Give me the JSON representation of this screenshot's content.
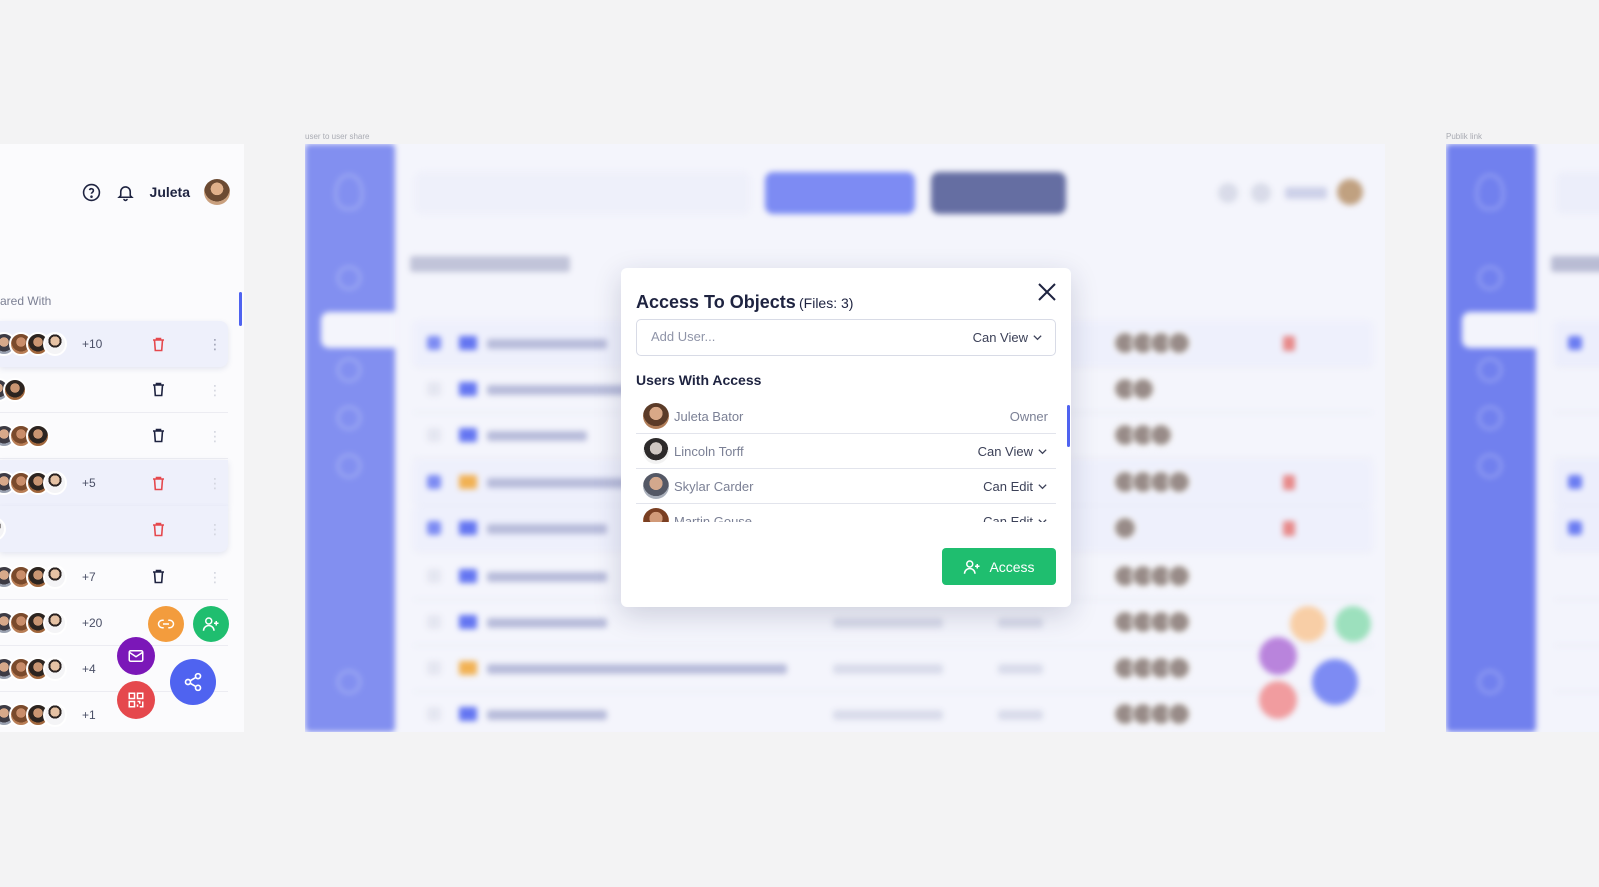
{
  "artboards": {
    "center_label": "user to user share",
    "right_label": "Publik link"
  },
  "header": {
    "username": "Juleta",
    "help_icon": "help-circle-icon",
    "bell_icon": "bell-icon"
  },
  "file_table": {
    "col_shared_with": "ared With",
    "rows": [
      {
        "count": "+10",
        "selected": true
      },
      {
        "count": "",
        "selected": false
      },
      {
        "count": "",
        "selected": false
      },
      {
        "count": "+5",
        "selected": true
      },
      {
        "count": "",
        "selected": true
      },
      {
        "count": "+7",
        "selected": false
      },
      {
        "count": "+20",
        "selected": false
      },
      {
        "count": "+4",
        "selected": false
      },
      {
        "count": "+1",
        "selected": false
      }
    ]
  },
  "share_menu": {
    "link_icon": "link-icon",
    "add_user_icon": "user-plus-icon",
    "mail_icon": "mail-icon",
    "share_icon": "share-icon",
    "qr_icon": "qr-code-icon"
  },
  "modal": {
    "title": "Access To Objects",
    "files_count": "(Files: 3)",
    "add_user_placeholder": "Add User...",
    "default_permission": "Can View",
    "users_heading": "Users With Access",
    "users": [
      {
        "name": "Juleta Bator",
        "role": "Owner"
      },
      {
        "name": "Lincoln Torff",
        "role": "Can View"
      },
      {
        "name": "Skylar Carder",
        "role": "Can Edit"
      },
      {
        "name": "Martin Gouse",
        "role": "Can Edit"
      }
    ],
    "access_button": "Access"
  },
  "colors": {
    "primary": "#4f63f0",
    "success": "#1fbe6f",
    "danger": "#e5484d",
    "orange": "#f39c3d",
    "purple": "#7b17b8"
  }
}
